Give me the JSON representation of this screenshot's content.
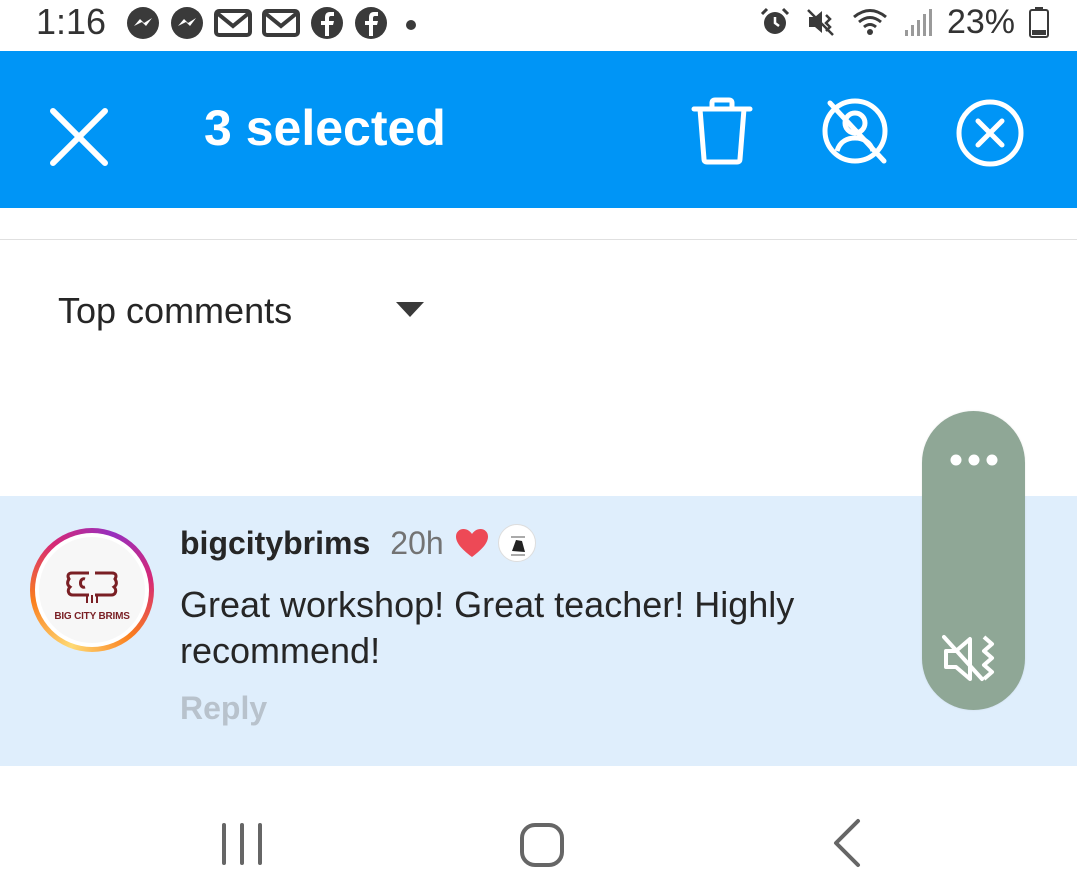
{
  "status_bar": {
    "time": "1:16",
    "notification_icons": [
      "messenger-icon",
      "messenger-icon",
      "gmail-icon",
      "gmail-icon",
      "facebook-icon",
      "facebook-icon",
      "more-dot-icon"
    ],
    "right_icons": [
      "alarm-icon",
      "vibrate-mute-icon",
      "wifi-icon",
      "signal-icon",
      "battery-icon"
    ],
    "battery": "23%"
  },
  "selection_bar": {
    "title": "3 selected",
    "color": "#0095f6",
    "actions": [
      "delete-icon",
      "restrict-icon",
      "block-icon"
    ]
  },
  "sort": {
    "label": "Top comments"
  },
  "comment": {
    "username": "bigcitybrims",
    "time": "20h",
    "liked_by_creator": true,
    "text": "Great workshop! Great teacher! Highly recommend!",
    "reply_label": "Reply",
    "avatar_brand": "BIG CITY BRIMS",
    "highlight_color": "#dfeefc"
  },
  "floating_controls": {
    "icons": [
      "more-icon",
      "volume-mute-icon"
    ],
    "color": "#8fa796"
  },
  "nav_bar": {
    "buttons": [
      "recent-apps",
      "home",
      "back"
    ]
  }
}
